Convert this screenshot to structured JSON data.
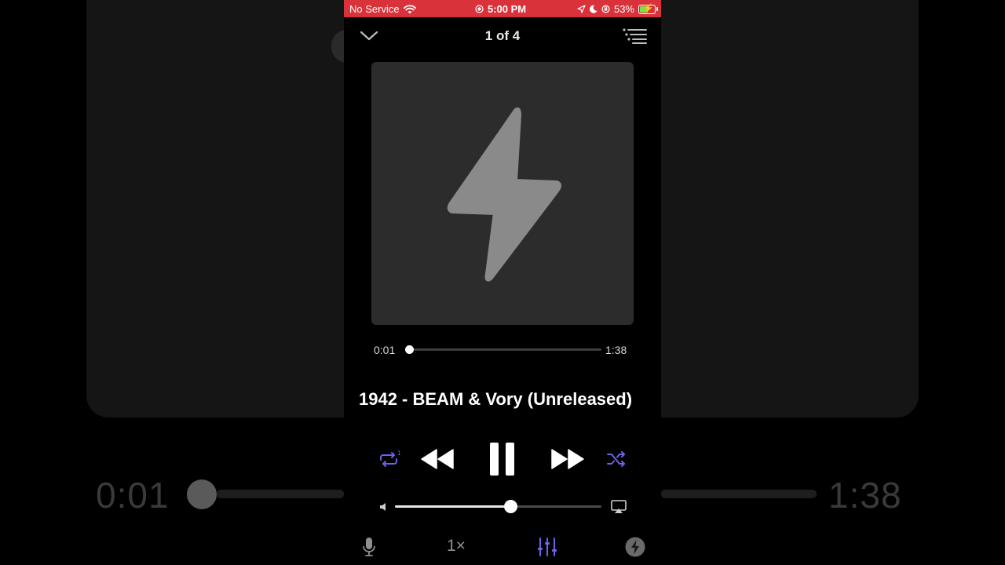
{
  "status_bar": {
    "carrier": "No Service",
    "time": "5:00 PM",
    "battery_percent": "53%",
    "bar_color": "#d9323a"
  },
  "header": {
    "queue_position": "1 of 4"
  },
  "artwork": {
    "icon": "lightning-bolt-icon"
  },
  "playback": {
    "elapsed": "0:01",
    "duration": "1:38",
    "progress_fraction": 0.01
  },
  "track": {
    "title": "1942 - BEAM & Vory (Unreleased)"
  },
  "controls": {
    "repeat_badge": "1",
    "accent_color": "#6b63e8"
  },
  "volume": {
    "level_fraction": 0.56
  },
  "bottom_bar": {
    "speed_label": "1×"
  },
  "backdrop": {
    "elapsed": "0:01",
    "duration": "1:38"
  }
}
